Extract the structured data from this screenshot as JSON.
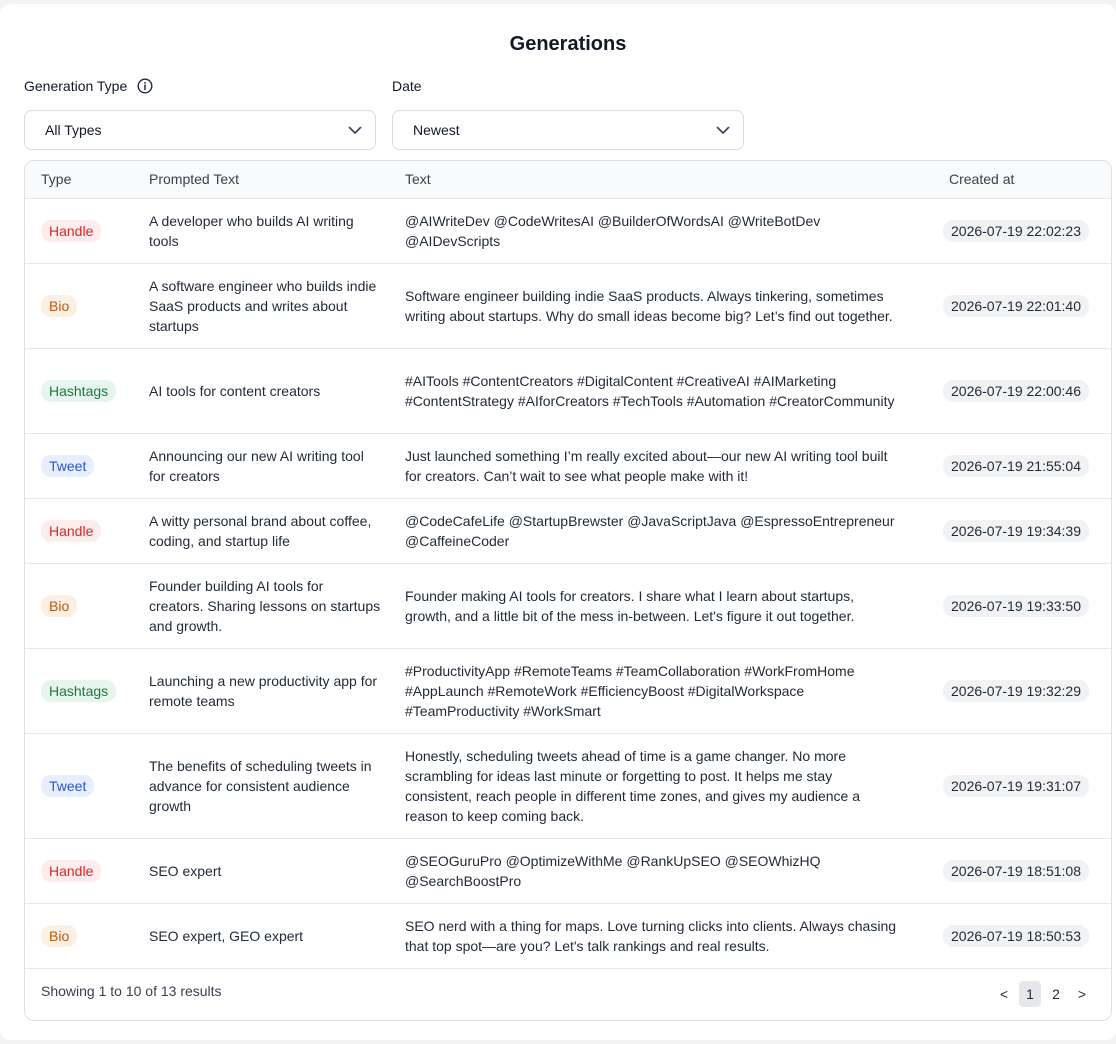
{
  "page": {
    "title": "Generations"
  },
  "filters": {
    "type": {
      "label": "Generation Type",
      "value": "All Types",
      "icon": "info-icon"
    },
    "date": {
      "label": "Date",
      "value": "Newest"
    }
  },
  "table": {
    "headers": [
      "Type",
      "Prompted Text",
      "Text",
      "Created at"
    ],
    "rows": [
      {
        "type": "Handle",
        "prompt": "A developer who builds AI writing tools",
        "text": "@AIWriteDev @CodeWritesAI @BuilderOfWordsAI @WriteBotDev @AIDevScripts",
        "created": "2026-07-19 22:02:23"
      },
      {
        "type": "Bio",
        "prompt": "A software engineer who builds indie SaaS products and writes about startups",
        "text": "Software engineer building indie SaaS products. Always tinkering, sometimes writing about startups. Why do small ideas become big? Let’s find out together.",
        "created": "2026-07-19 22:01:40"
      },
      {
        "type": "Hashtags",
        "prompt": "AI tools for content creators",
        "text": "#AITools #ContentCreators #DigitalContent #CreativeAI #AIMarketing #ContentStrategy #AIforCreators #TechTools #Automation #CreatorCommunity",
        "created": "2026-07-19 22:00:46"
      },
      {
        "type": "Tweet",
        "prompt": "Announcing our new AI writing tool for creators",
        "text": "Just launched something I’m really excited about—our new AI writing tool built for creators. Can’t wait to see what people make with it!",
        "created": "2026-07-19 21:55:04"
      },
      {
        "type": "Handle",
        "prompt": "A witty personal brand about coffee, coding, and startup life",
        "text": "@CodeCafeLife @StartupBrewster @JavaScriptJava @EspressoEntrepreneur @CaffeineCoder",
        "created": "2026-07-19 19:34:39"
      },
      {
        "type": "Bio",
        "prompt": "Founder building AI tools for creators. Sharing lessons on startups and growth.",
        "text": "Founder making AI tools for creators. I share what I learn about startups, growth, and a little bit of the mess in-between. Let's figure it out together.",
        "created": "2026-07-19 19:33:50"
      },
      {
        "type": "Hashtags",
        "prompt": "Launching a new productivity app for remote teams",
        "text": "#ProductivityApp #RemoteTeams #TeamCollaboration #WorkFromHome #AppLaunch #RemoteWork #EfficiencyBoost #DigitalWorkspace #TeamProductivity #WorkSmart",
        "created": "2026-07-19 19:32:29"
      },
      {
        "type": "Tweet",
        "prompt": "The benefits of scheduling tweets in advance for consistent audience growth",
        "text": "Honestly, scheduling tweets ahead of time is a game changer. No more scrambling for ideas last minute or forgetting to post. It helps me stay consistent, reach people in different time zones, and gives my audience a reason to keep coming back.",
        "created": "2026-07-19 19:31:07"
      },
      {
        "type": "Handle",
        "prompt": "SEO expert",
        "text": "@SEOGuruPro @OptimizeWithMe @RankUpSEO @SEOWhizHQ @SearchBoostPro",
        "created": "2026-07-19 18:51:08"
      },
      {
        "type": "Bio",
        "prompt": "SEO expert, GEO expert",
        "text": "SEO nerd with a thing for maps. Love turning clicks into clients. Always chasing that top spot—are you? Let's talk rankings and real results.",
        "created": "2026-07-19 18:50:53"
      }
    ]
  },
  "footer": {
    "summary": "Showing 1 to 10 of 13 results",
    "pagination": {
      "prev": "<",
      "pages": [
        "1",
        "2"
      ],
      "next": ">",
      "current": "1"
    }
  },
  "colors": {
    "Handle": "#d02a2a",
    "Bio": "#b75b12",
    "Hashtags": "#1b7a3e",
    "Tweet": "#2457c9"
  }
}
